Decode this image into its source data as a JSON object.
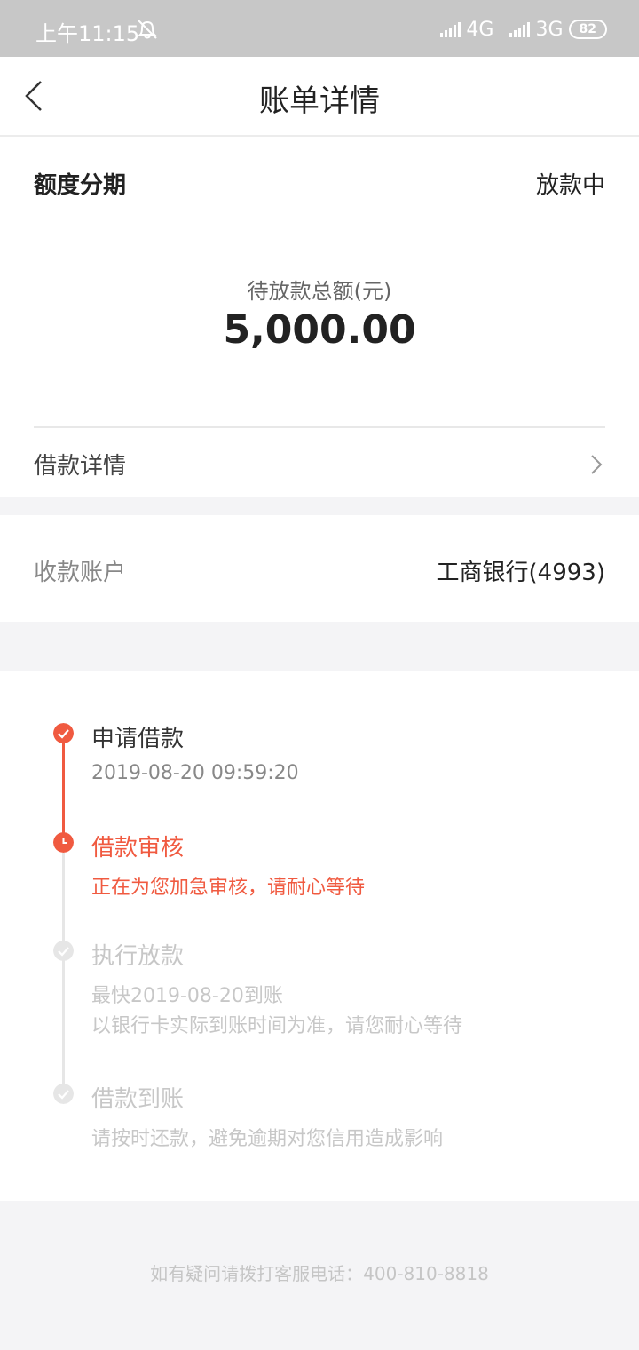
{
  "status_bar": {
    "time": "上午11:15",
    "network1": "4G",
    "network2": "3G",
    "battery": "82"
  },
  "nav": {
    "title": "账单详情"
  },
  "summary": {
    "product": "额度分期",
    "status": "放款中",
    "amount_label": "待放款总额(元)",
    "amount": "5,000.00",
    "loan_detail_label": "借款详情"
  },
  "account": {
    "label": "收款账户",
    "value": "工商银行(4993)"
  },
  "timeline": [
    {
      "title": "申请借款",
      "lines": [
        "2019-08-20 09:59:20"
      ],
      "state": "done"
    },
    {
      "title": "借款审核",
      "lines": [
        "正在为您加急审核，请耐心等待"
      ],
      "state": "current"
    },
    {
      "title": "执行放款",
      "lines": [
        "最快2019-08-20到账",
        "以银行卡实际到账时间为准，请您耐心等待"
      ],
      "state": "pending"
    },
    {
      "title": "借款到账",
      "lines": [
        "请按时还款，避免逾期对您信用造成影响"
      ],
      "state": "pending"
    }
  ],
  "footer": {
    "hotline": "如有疑问请拨打客服电话：400-810-8818"
  },
  "colors": {
    "accent": "#f05a40",
    "pending": "#c7c7c7",
    "background": "#f4f4f6"
  },
  "icons": {
    "back": "chevron-left-icon",
    "forward": "chevron-right-icon",
    "mute": "bell-off-icon",
    "done": "check-icon",
    "current": "clock-icon"
  }
}
